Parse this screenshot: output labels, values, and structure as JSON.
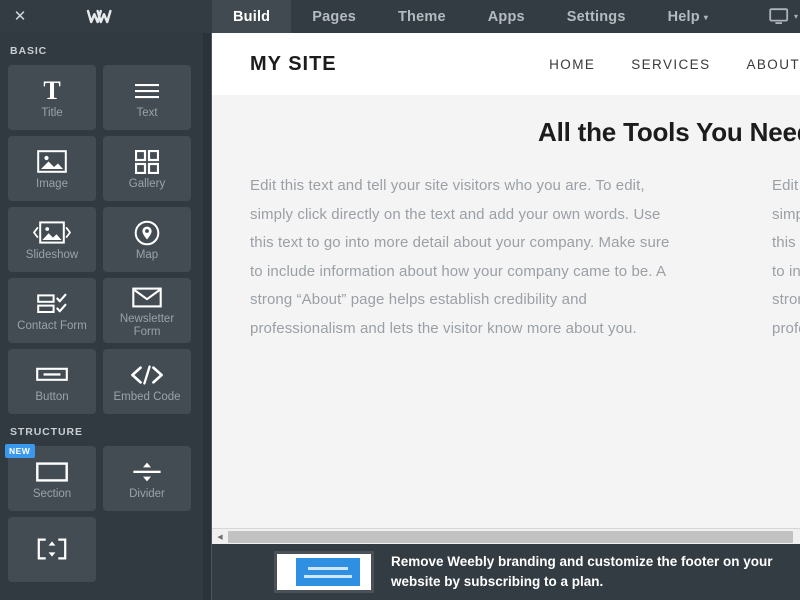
{
  "topbar": {
    "close_label": "✕",
    "logo_name": "weebly-logo",
    "nav": [
      {
        "label": "Build",
        "active": true,
        "caret": false
      },
      {
        "label": "Pages",
        "active": false,
        "caret": false
      },
      {
        "label": "Theme",
        "active": false,
        "caret": false
      },
      {
        "label": "Apps",
        "active": false,
        "caret": false
      },
      {
        "label": "Settings",
        "active": false,
        "caret": false
      },
      {
        "label": "Help",
        "active": false,
        "caret": true
      }
    ],
    "help_caret": "▾",
    "device_icon": "monitor-icon",
    "device_caret": "▾"
  },
  "sidebar": {
    "sections": [
      {
        "label": "BASIC",
        "tiles": [
          {
            "label": "Title",
            "icon": "title-icon",
            "badge": null
          },
          {
            "label": "Text",
            "icon": "text-icon",
            "badge": null
          },
          {
            "label": "Image",
            "icon": "image-icon",
            "badge": null
          },
          {
            "label": "Gallery",
            "icon": "gallery-icon",
            "badge": null
          },
          {
            "label": "Slideshow",
            "icon": "slideshow-icon",
            "badge": null
          },
          {
            "label": "Map",
            "icon": "map-pin-icon",
            "badge": null
          },
          {
            "label": "Contact Form",
            "icon": "contact-form-icon",
            "badge": null
          },
          {
            "label": "Newsletter Form",
            "icon": "newsletter-form-icon",
            "badge": null
          },
          {
            "label": "Button",
            "icon": "button-icon",
            "badge": null
          },
          {
            "label": "Embed Code",
            "icon": "embed-code-icon",
            "badge": null
          }
        ]
      },
      {
        "label": "STRUCTURE",
        "tiles": [
          {
            "label": "Section",
            "icon": "section-icon",
            "badge": "NEW"
          },
          {
            "label": "Divider",
            "icon": "divider-icon",
            "badge": null
          },
          {
            "label": "",
            "icon": "spacer-icon",
            "badge": null
          }
        ]
      }
    ]
  },
  "preview": {
    "site_logo": "MY SITE",
    "site_nav": [
      "HOME",
      "SERVICES",
      "ABOUT"
    ],
    "heading": "All the Tools You Need",
    "body_text": "Edit this text and tell your site visitors who you are. To edit, simply click directly on the text and add your own words. Use this text to go into more detail about your company. Make sure to include information about how your company came to be. A strong “About” page helps establish credibility and professionalism and lets the visitor know more about you."
  },
  "scrollbar": {
    "left_arrow": "◀"
  },
  "banner": {
    "text": "Remove Weebly branding and customize the footer on your website by subscribing to a plan."
  },
  "colors": {
    "sidebar_bg": "#313a40",
    "topbar_bg": "#333c42",
    "tile_bg": "#434c52",
    "active_tab_bg": "#404a50",
    "badge_blue": "#3a99ed",
    "canvas_bg": "#f4f4f4",
    "body_text": "#9aa0a6",
    "thumb_blue": "#2f8fe0"
  }
}
